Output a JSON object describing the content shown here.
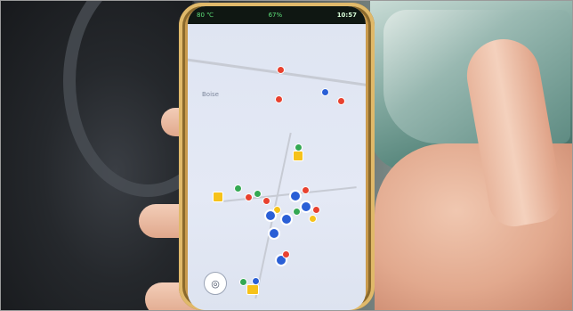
{
  "status_bar": {
    "left_text": "80 ℃",
    "center_text": "67%",
    "time": "10:57"
  },
  "map": {
    "place_label": "Boise",
    "locate_icon": "locate-icon"
  },
  "colors": {
    "marker_red": "#e8412f",
    "marker_blue": "#2a5fd6",
    "marker_green": "#34a853",
    "marker_yellow": "#f6c21a",
    "status_green": "#5ee07a"
  }
}
